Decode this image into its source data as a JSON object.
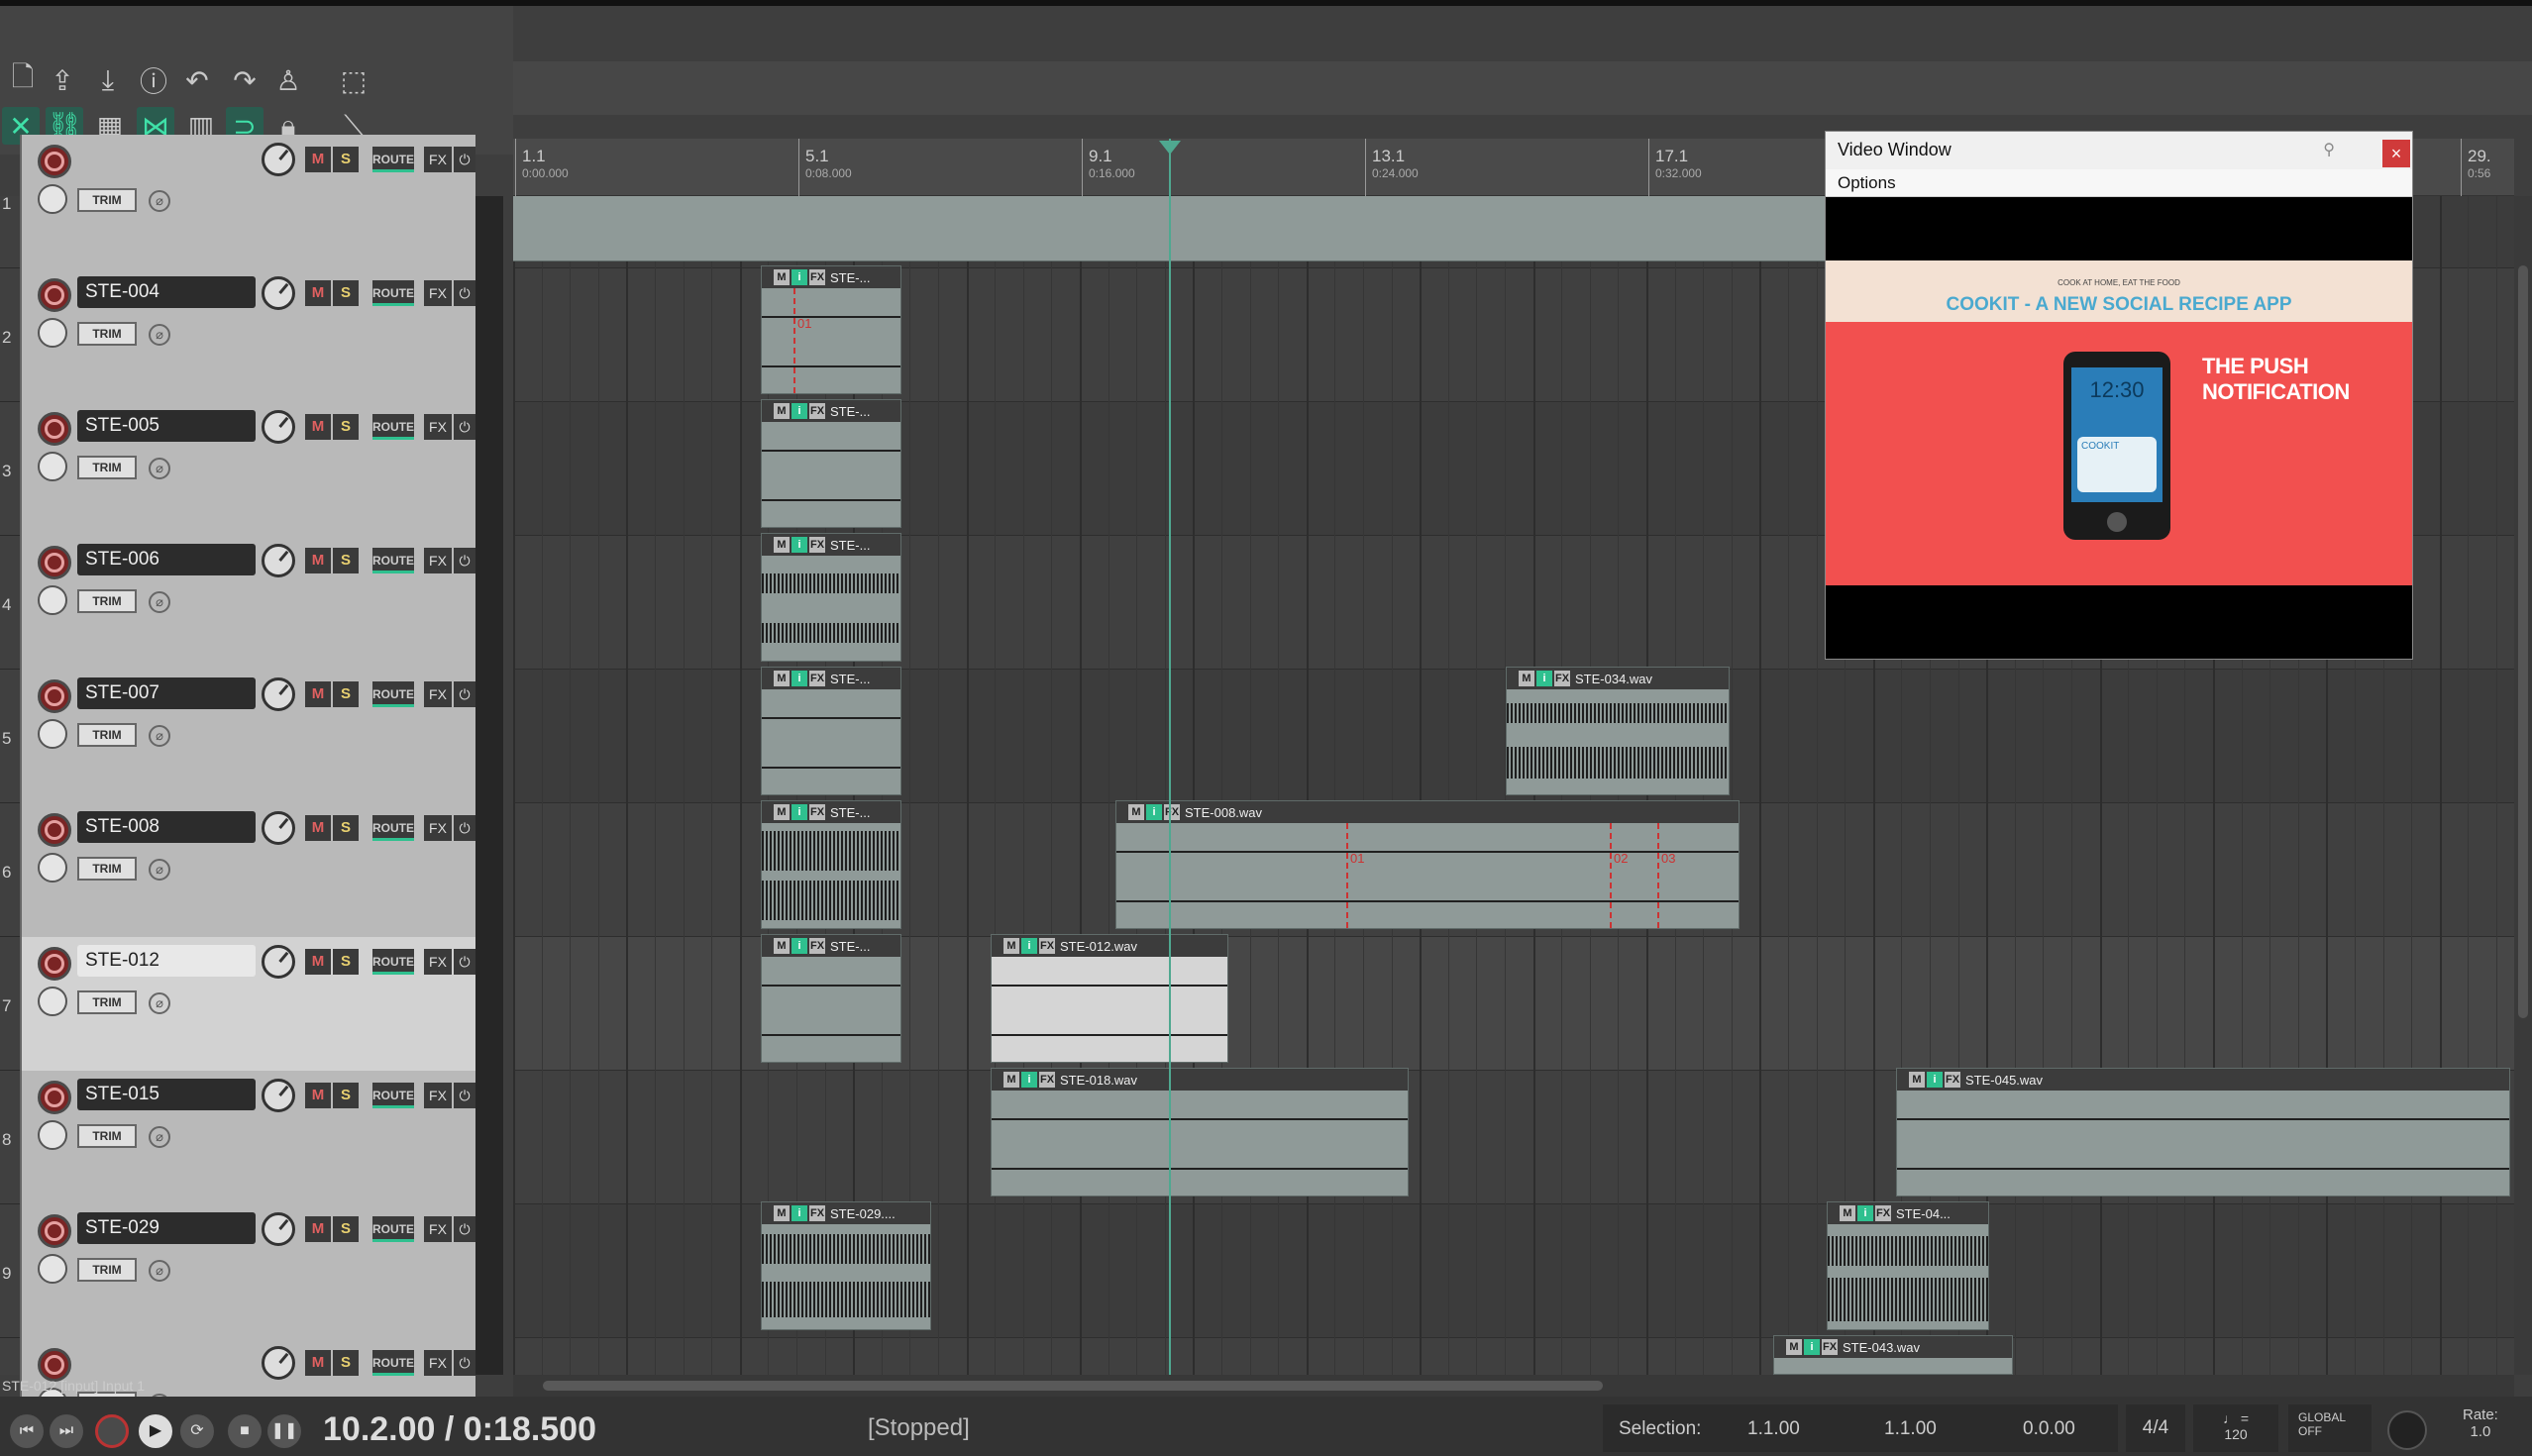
{
  "ruler": {
    "marks": [
      {
        "bar": "1.1",
        "time": "0:00.000"
      },
      {
        "bar": "5.1",
        "time": "0:08.000"
      },
      {
        "bar": "9.1",
        "time": "0:16.000"
      },
      {
        "bar": "13.1",
        "time": "0:24.000"
      },
      {
        "bar": "17.1",
        "time": "0:32.000"
      },
      {
        "bar": "29.",
        "time": "0:56"
      }
    ]
  },
  "tracks": [
    {
      "num": "1",
      "name": ""
    },
    {
      "num": "2",
      "name": "STE-004"
    },
    {
      "num": "3",
      "name": "STE-005"
    },
    {
      "num": "4",
      "name": "STE-006"
    },
    {
      "num": "5",
      "name": "STE-007"
    },
    {
      "num": "6",
      "name": "STE-008"
    },
    {
      "num": "7",
      "name": "STE-012"
    },
    {
      "num": "8",
      "name": "STE-015"
    },
    {
      "num": "9",
      "name": "STE-029"
    },
    {
      "num": "",
      "name": ""
    }
  ],
  "track_buttons": {
    "mute": "M",
    "solo": "S",
    "route": "ROUTE",
    "fx": "FX",
    "power": "⏻",
    "trim": "TRIM",
    "phase": "⌀"
  },
  "items": {
    "t2a": "STE-...",
    "t3a": "STE-...",
    "t4a": "STE-...",
    "t5a": "STE-...",
    "t5b": "STE-034.wav",
    "t6a": "STE-...",
    "t6b": "STE-008.wav",
    "t7a": "STE-...",
    "t7b": "STE-012.wav",
    "t8a": "STE-018.wav",
    "t8b": "STE-045.wav",
    "t9a": "STE-029....",
    "t9b": "STE-04...",
    "t10a": "STE-043.wav"
  },
  "item_buttons": {
    "mute": "M",
    "info": "i",
    "fx": "FX"
  },
  "markers": {
    "m01": "01",
    "m02": "02",
    "m03": "03"
  },
  "video_window": {
    "title": "Video Window",
    "menu": "Options",
    "close": "×",
    "frame": {
      "tagline": "COOK AT HOME, EAT THE FOOD",
      "app_title": "COOKIT - A NEW SOCIAL RECIPE APP",
      "phone_time": "12:30",
      "notif_app": "COOKIT",
      "callout": "THE PUSH NOTIFICATION"
    }
  },
  "status_bar": {
    "text": "STE-012 [input] Input 1"
  },
  "transport": {
    "position": "10.2.00 / 0:18.500",
    "state": "[Stopped]",
    "selection_label": "Selection:",
    "sel_start": "1.1.00",
    "sel_end": "1.1.00",
    "sel_length": "0.0.00",
    "time_sig": "4/4",
    "bpm_symbol": "♩ =",
    "bpm": "120",
    "global_label": "GLOBAL",
    "global_state": "OFF",
    "rate_label": "Rate:",
    "rate_value": "1.0"
  },
  "colors": {
    "accent": "#2fc08f",
    "record": "#b33333",
    "playhead": "#4fa890",
    "marker": "#cc3333",
    "video_bg": "#f2504f"
  }
}
